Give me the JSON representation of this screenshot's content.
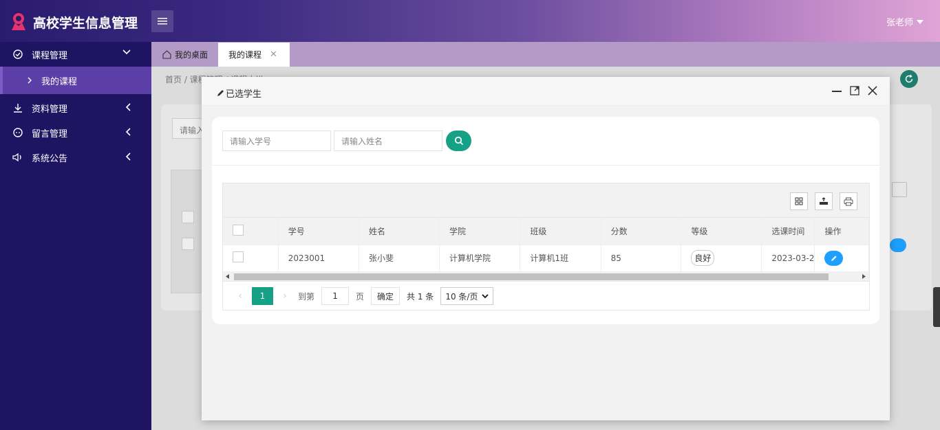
{
  "header": {
    "app_title": "高校学生信息管理",
    "user_name": "张老师"
  },
  "sidebar": {
    "items": [
      {
        "label": "课程管理"
      },
      {
        "label": "资料管理"
      },
      {
        "label": "留言管理"
      },
      {
        "label": "系统公告"
      }
    ],
    "sub_item": "我的课程"
  },
  "tabs": {
    "home": "我的桌面",
    "active": "我的课程"
  },
  "background": {
    "breadcrumb": "首页  /  课程管理  /  课程中进",
    "search_partial": "请输入"
  },
  "dialog": {
    "title": "已选学生",
    "search": {
      "student_id_placeholder": "请输入学号",
      "name_placeholder": "请输入姓名"
    },
    "table": {
      "columns": [
        "学号",
        "姓名",
        "学院",
        "班级",
        "分数",
        "等级",
        "选课时间",
        "操作"
      ],
      "rows": [
        {
          "student_id": "2023001",
          "name": "张小斐",
          "college": "计算机学院",
          "class": "计算机1班",
          "score": "85",
          "grade": "良好",
          "time": "2023-03-2"
        }
      ]
    },
    "pager": {
      "current": "1",
      "goto_label": "到第",
      "goto_value": "1",
      "page_label": "页",
      "confirm": "确定",
      "total": "共 1 条",
      "page_size": "10 条/页"
    }
  }
}
